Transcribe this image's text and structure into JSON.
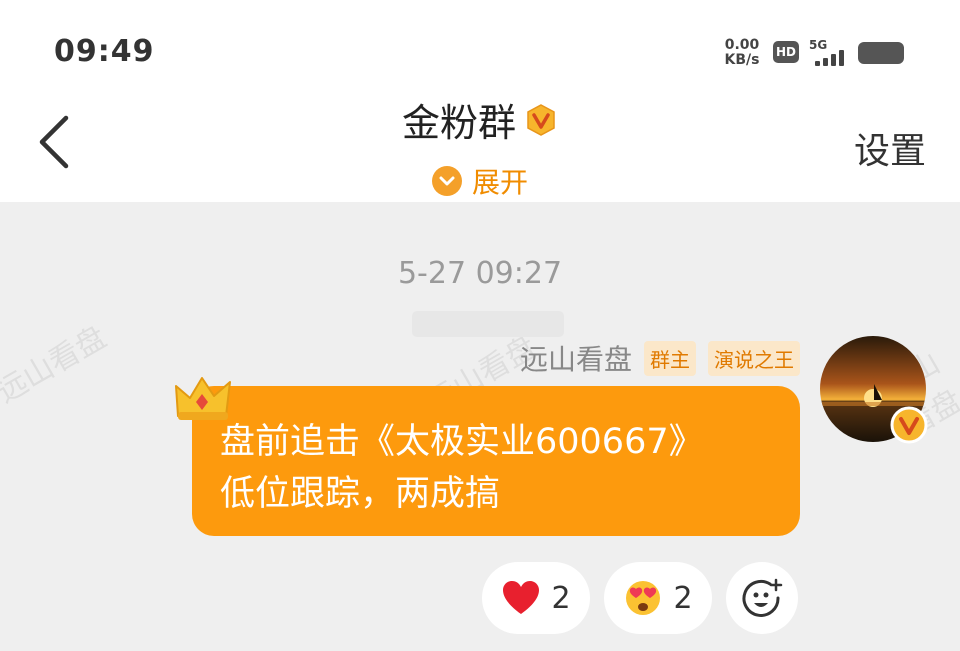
{
  "status_bar": {
    "time": "09:49",
    "net_speed_value": "0.00",
    "net_speed_unit": "KB/s",
    "hd_label": "HD",
    "signal_label": "5G"
  },
  "header": {
    "back_icon": "chevron-left-icon",
    "title": "金粉群",
    "expand_label": "展开",
    "settings_label": "设置"
  },
  "chat": {
    "timestamp": "5-27 09:27",
    "message": {
      "sender": "远山看盘",
      "tags": [
        "群主",
        "演说之王"
      ],
      "text_line1": "盘前追击《太极实业600667》",
      "text_line2": "低位跟踪，两成搞",
      "bubble_color": "#fd9a0d"
    },
    "reactions": [
      {
        "icon": "heart-icon",
        "count": "2"
      },
      {
        "icon": "heart-eyes-emoji-icon",
        "count": "2"
      },
      {
        "icon": "add-reaction-icon"
      }
    ]
  },
  "watermark_text": "远山看盘",
  "colors": {
    "accent": "#f08c00",
    "background": "#efefef"
  }
}
